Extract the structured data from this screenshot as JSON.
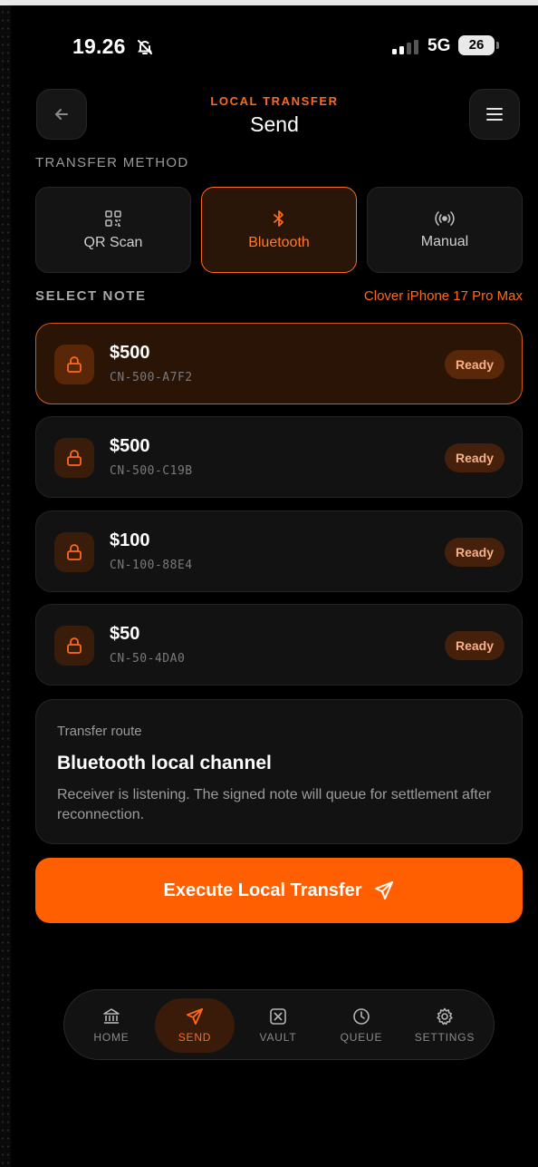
{
  "status_bar": {
    "time": "19.26",
    "network": "5G",
    "battery": "26"
  },
  "header": {
    "kicker": "LOCAL TRANSFER",
    "title": "Send"
  },
  "transfer_method": {
    "label": "TRANSFER METHOD",
    "options": [
      {
        "label": "QR Scan",
        "icon": "qr-code-icon",
        "selected": false
      },
      {
        "label": "Bluetooth",
        "icon": "bluetooth-icon",
        "selected": true
      },
      {
        "label": "Manual",
        "icon": "broadcast-icon",
        "selected": false
      }
    ]
  },
  "select_note": {
    "label": "SELECT NOTE",
    "device": "Clover iPhone 17 Pro Max",
    "notes": [
      {
        "amount": "$500",
        "code": "CN-500-A7F2",
        "status": "Ready",
        "selected": true
      },
      {
        "amount": "$500",
        "code": "CN-500-C19B",
        "status": "Ready",
        "selected": false
      },
      {
        "amount": "$100",
        "code": "CN-100-88E4",
        "status": "Ready",
        "selected": false
      },
      {
        "amount": "$50",
        "code": "CN-50-4DA0",
        "status": "Ready",
        "selected": false
      }
    ]
  },
  "route": {
    "kicker": "Transfer route",
    "title": "Bluetooth local channel",
    "description": "Receiver is listening. The signed note will queue for settlement after reconnection."
  },
  "execute": {
    "label": "Execute Local Transfer"
  },
  "nav": {
    "items": [
      {
        "label": "HOME",
        "icon": "bank-icon",
        "active": false
      },
      {
        "label": "SEND",
        "icon": "send-icon",
        "active": true
      },
      {
        "label": "VAULT",
        "icon": "vault-icon",
        "active": false
      },
      {
        "label": "QUEUE",
        "icon": "clock-icon",
        "active": false
      },
      {
        "label": "SETTINGS",
        "icon": "gear-icon",
        "active": false
      }
    ]
  },
  "colors": {
    "accent": "#ff5f00",
    "background": "#000000",
    "card": "#121212"
  }
}
